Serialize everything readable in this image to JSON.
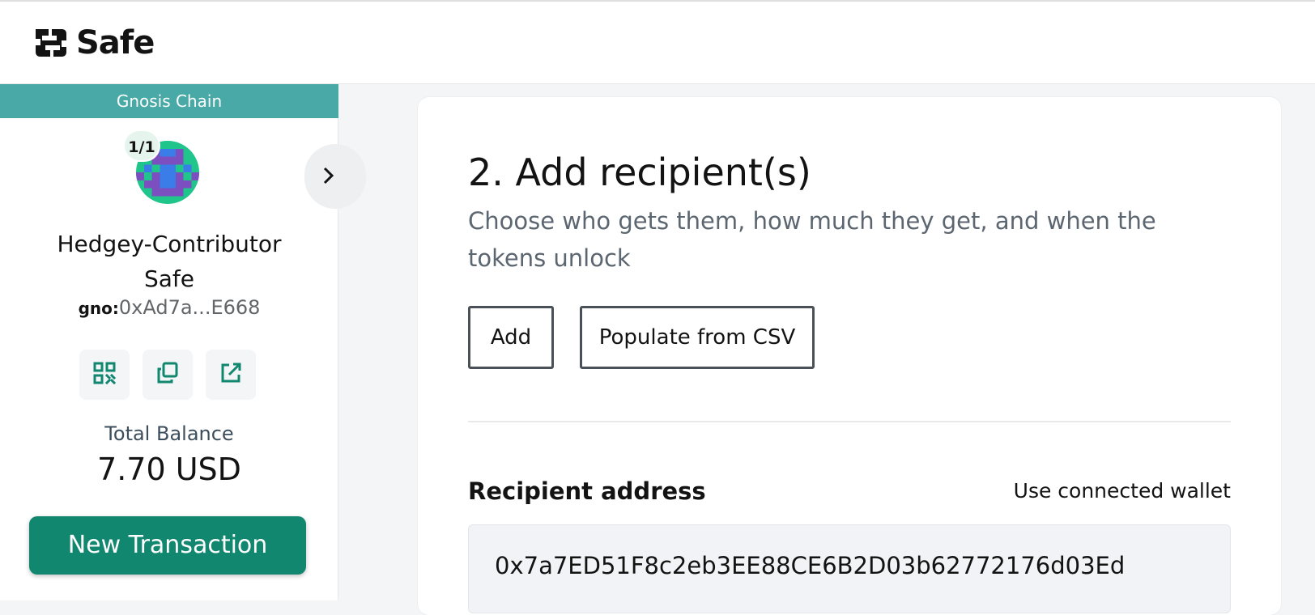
{
  "app": {
    "brand": "Safe"
  },
  "sidebar": {
    "chain": "Gnosis Chain",
    "threshold": "1/1",
    "safe_name_line1": "Hedgey-Contributor",
    "safe_name_line2": "Safe",
    "address_prefix": "gno:",
    "address_short": "0xAd7a...E668",
    "icons": [
      "qr-code-icon",
      "copy-icon",
      "external-link-icon"
    ],
    "balance_label": "Total Balance",
    "balance_value": "7.70 USD",
    "new_transaction_label": "New Transaction",
    "accent_color": "#12876f",
    "chain_color": "#48a9a6"
  },
  "main": {
    "step_title": "2. Add recipient(s)",
    "step_description": "Choose who gets them, how much they get, and when the tokens unlock",
    "add_button": "Add",
    "csv_button": "Populate from CSV",
    "recipient_label": "Recipient address",
    "use_wallet_link": "Use connected wallet",
    "recipient_value": "0x7a7ED51F8c2eb3EE88CE6B2D03b62772176d03Ed"
  }
}
